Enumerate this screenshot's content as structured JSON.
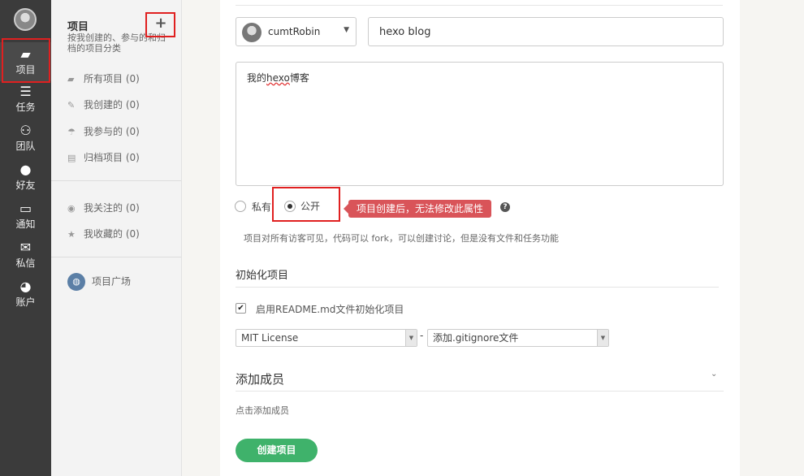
{
  "nav": {
    "items": [
      {
        "label": "项目",
        "icon": "folder-icon"
      },
      {
        "label": "任务",
        "icon": "task-icon"
      },
      {
        "label": "团队",
        "icon": "team-icon"
      },
      {
        "label": "好友",
        "icon": "friend-icon"
      },
      {
        "label": "通知",
        "icon": "inbox-icon"
      },
      {
        "label": "私信",
        "icon": "mail-icon"
      },
      {
        "label": "账户",
        "icon": "dashboard-icon"
      }
    ]
  },
  "sidebar": {
    "title": "项目",
    "description": "按我创建的、参与的和归档的项目分类",
    "add_label": "+",
    "items": [
      {
        "label": "所有项目 (0)",
        "icon": "folder-icon"
      },
      {
        "label": "我创建的 (0)",
        "icon": "edit-icon"
      },
      {
        "label": "我参与的 (0)",
        "icon": "umbrella-icon"
      },
      {
        "label": "归档项目 (0)",
        "icon": "archive-icon"
      }
    ],
    "follow_items": [
      {
        "label": "我关注的 (0)",
        "icon": "eye-icon"
      },
      {
        "label": "我收藏的 (0)",
        "icon": "star-icon"
      }
    ],
    "plaza_label": "项目广场"
  },
  "form": {
    "owner_name": "cumtRobin",
    "project_name": "hexo blog",
    "description_prefix": "我的",
    "description_misspelled": "hexo",
    "description_suffix": "博客",
    "private_label": "私有",
    "public_label": "公开",
    "selected_visibility": "公开",
    "tooltip": "项目创建后，无法修改此属性",
    "help_icon": "?",
    "public_help": "项目对所有访客可见，代码可以 fork，可以创建讨论，但是没有文件和任务功能",
    "init_title": "初始化项目",
    "readme_label": "启用README.md文件初始化项目",
    "readme_checked": true,
    "license_value": "MIT License",
    "separator": "-",
    "gitignore_value": "添加.gitignore文件",
    "members_title": "添加成员",
    "members_hint": "点击添加成员",
    "submit_label": "创建项目"
  },
  "colors": {
    "highlight_box": "#e02020",
    "tooltip_bg": "#d95459",
    "submit_bg": "#3fb26b",
    "nav_bg": "#3b3b3b"
  }
}
